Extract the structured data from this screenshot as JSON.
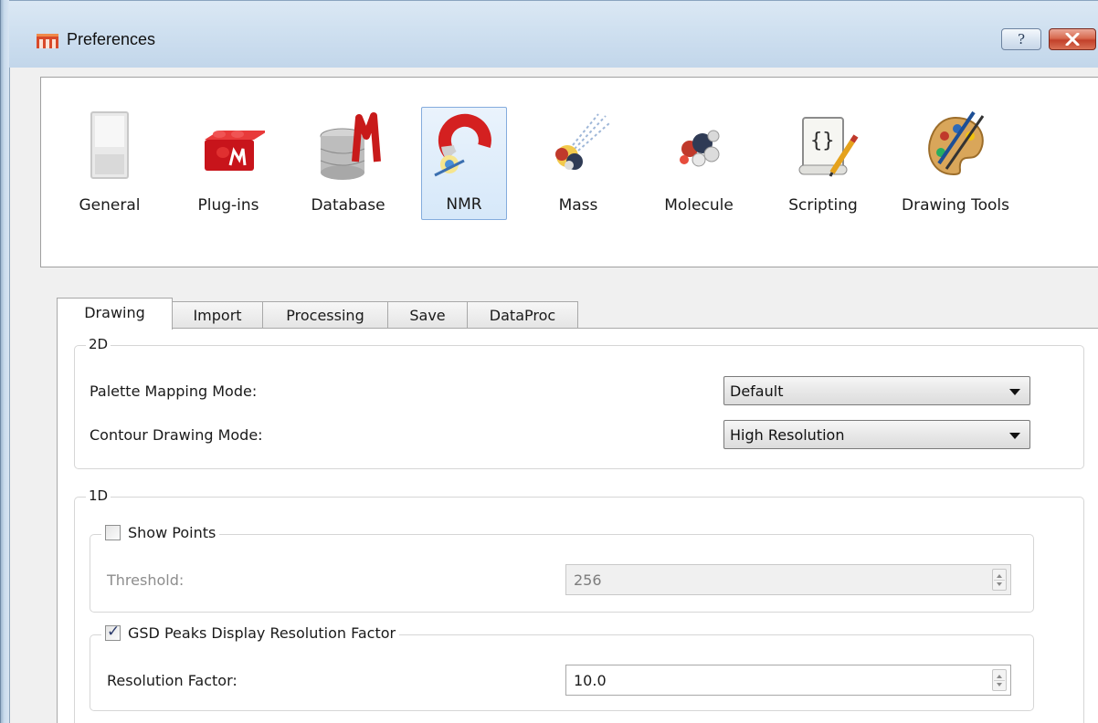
{
  "window": {
    "title": "Preferences",
    "help_glyph": "?",
    "accent_close": "#c8482f"
  },
  "categories": [
    {
      "label": "General",
      "icon": "general-switch-icon",
      "selected": false
    },
    {
      "label": "Plug-ins",
      "icon": "plugins-brick-icon",
      "selected": false
    },
    {
      "label": "Database",
      "icon": "database-cylinder-icon",
      "selected": false
    },
    {
      "label": "NMR",
      "icon": "nmr-magnet-icon",
      "selected": true
    },
    {
      "label": "Mass",
      "icon": "mass-spectrometry-icon",
      "selected": false
    },
    {
      "label": "Molecule",
      "icon": "molecule-icon",
      "selected": false
    },
    {
      "label": "Scripting",
      "icon": "scripting-scroll-icon",
      "selected": false
    },
    {
      "label": "Drawing Tools",
      "icon": "drawing-palette-icon",
      "selected": false
    }
  ],
  "tabs": [
    {
      "label": "Drawing",
      "active": true
    },
    {
      "label": "Import",
      "active": false
    },
    {
      "label": "Processing",
      "active": false
    },
    {
      "label": "Save",
      "active": false
    },
    {
      "label": "DataProc",
      "active": false
    }
  ],
  "drawing": {
    "group_2d": {
      "title": "2D",
      "palette_label": "Palette Mapping Mode:",
      "palette_value": "Default",
      "contour_label": "Contour Drawing Mode:",
      "contour_value": "High Resolution"
    },
    "group_1d": {
      "title": "1D",
      "show_points": {
        "label": "Show Points",
        "checked": false,
        "threshold_label": "Threshold:",
        "threshold_value": "256"
      },
      "gsd": {
        "label": "GSD Peaks Display Resolution Factor",
        "checked": true,
        "check_glyph": "✓",
        "factor_label": "Resolution Factor:",
        "factor_value": "10.0"
      }
    }
  }
}
